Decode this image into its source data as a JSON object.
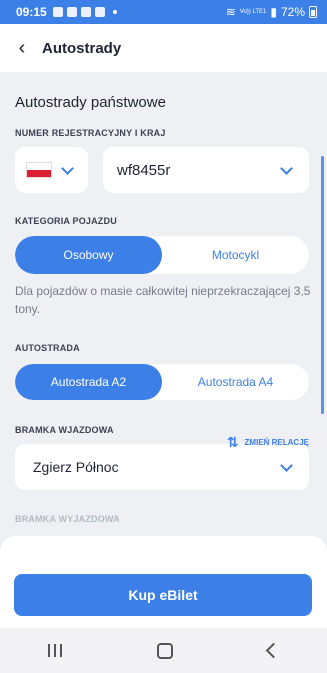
{
  "status_bar": {
    "time": "09:15",
    "battery": "72%",
    "network_label": "Vo)) LTE1"
  },
  "header": {
    "title": "Autostrady"
  },
  "main": {
    "section_title": "Autostrady państwowe",
    "registration": {
      "label": "NUMER REJESTRACYJNY I KRAJ",
      "country_flag": "poland-flag-icon",
      "plate_value": "wf8455r"
    },
    "vehicle_category": {
      "label": "KATEGORIA POJAZDU",
      "options": [
        "Osobowy",
        "Motocykl"
      ],
      "selected": "Osobowy"
    },
    "hint": "Dla pojazdów o masie całkowitej nieprzekraczającej 3,5 tony.",
    "highway": {
      "label": "AUTOSTRADA",
      "options": [
        "Autostrada A2",
        "Autostrada A4"
      ],
      "selected": "Autostrada A2"
    },
    "entry_gate": {
      "label": "BRAMKA WJAZDOWA",
      "value": "Zgierz Północ"
    },
    "swap_label": "ZMIEŃ RELACJĘ",
    "exit_gate": {
      "label": "BRAMKA WYJAZDOWA"
    }
  },
  "footer": {
    "buy_label": "Kup eBilet"
  },
  "colors": {
    "accent": "#3c7fe6",
    "background": "#eef0f4"
  }
}
